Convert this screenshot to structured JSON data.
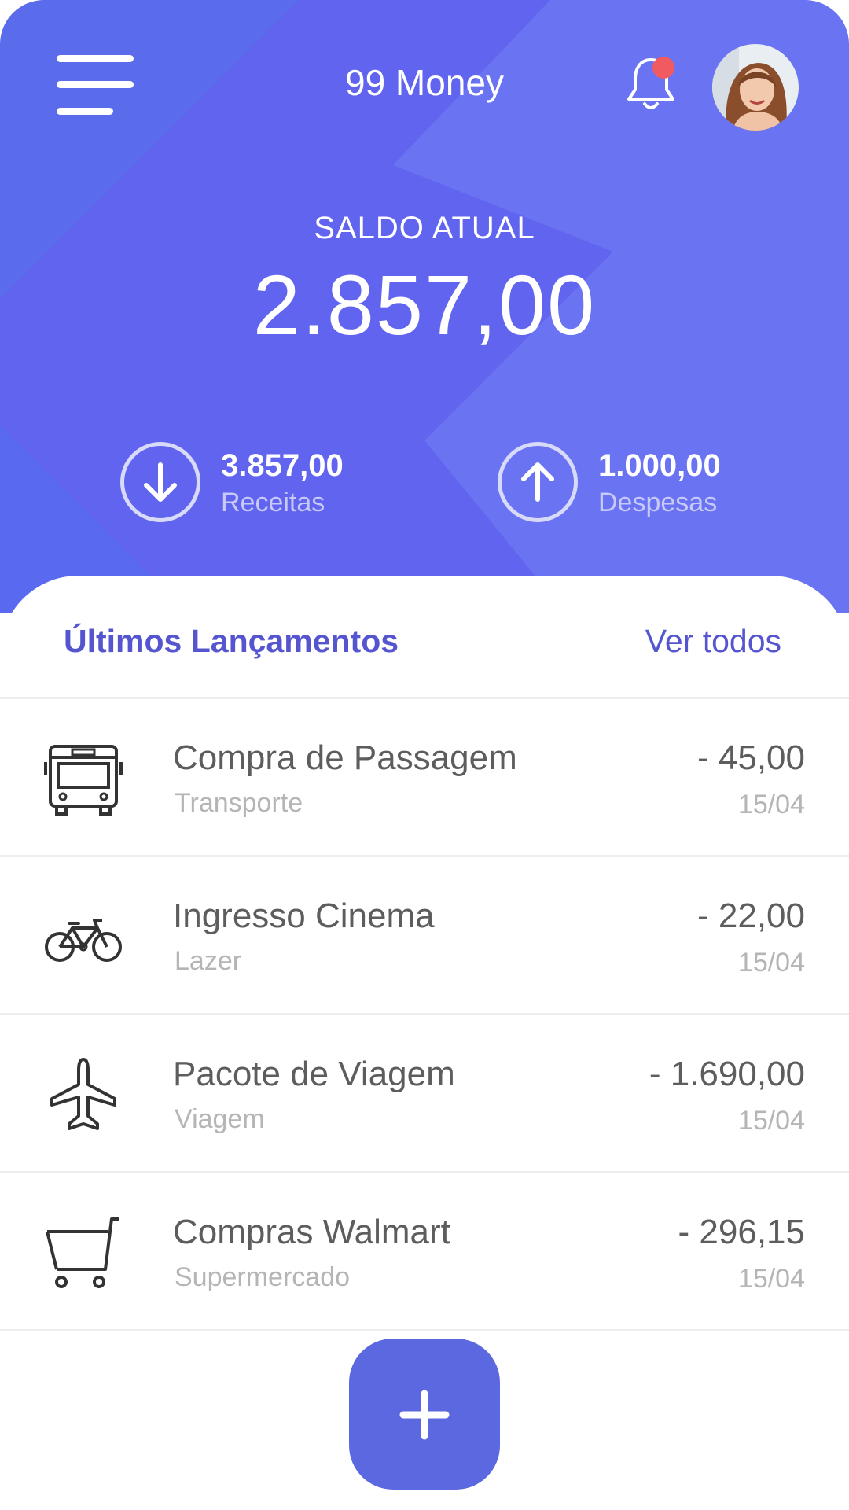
{
  "header": {
    "title": "99 Money",
    "icons": [
      "menu-icon",
      "bell-icon",
      "user-avatar"
    ]
  },
  "balance": {
    "label": "SALDO ATUAL",
    "value": "2.857,00"
  },
  "summary": {
    "income": {
      "amount": "3.857,00",
      "label": "Receitas",
      "icon": "arrow-down-circle-icon"
    },
    "expenses": {
      "amount": "1.000,00",
      "label": "Despesas",
      "icon": "arrow-up-circle-icon"
    }
  },
  "transactions": {
    "title": "Últimos Lançamentos",
    "see_all": "Ver todos",
    "items": [
      {
        "name": "Compra de Passagem",
        "category": "Transporte",
        "amount": "- 45,00",
        "date": "15/04",
        "icon": "bus-icon"
      },
      {
        "name": "Ingresso Cinema",
        "category": "Lazer",
        "amount": "- 22,00",
        "date": "15/04",
        "icon": "bicycle-icon"
      },
      {
        "name": "Pacote de Viagem",
        "category": "Viagem",
        "amount": "- 1.690,00",
        "date": "15/04",
        "icon": "airplane-icon"
      },
      {
        "name": "Compras Walmart",
        "category": "Supermercado",
        "amount": "- 296,15",
        "date": "15/04",
        "icon": "shopping-cart-icon"
      }
    ]
  },
  "fab": {
    "icon": "plus-icon"
  },
  "colors": {
    "hero": "#6064EF",
    "accent": "#5556CF",
    "fab": "#5B68E0",
    "notification": "#F15B5F"
  }
}
